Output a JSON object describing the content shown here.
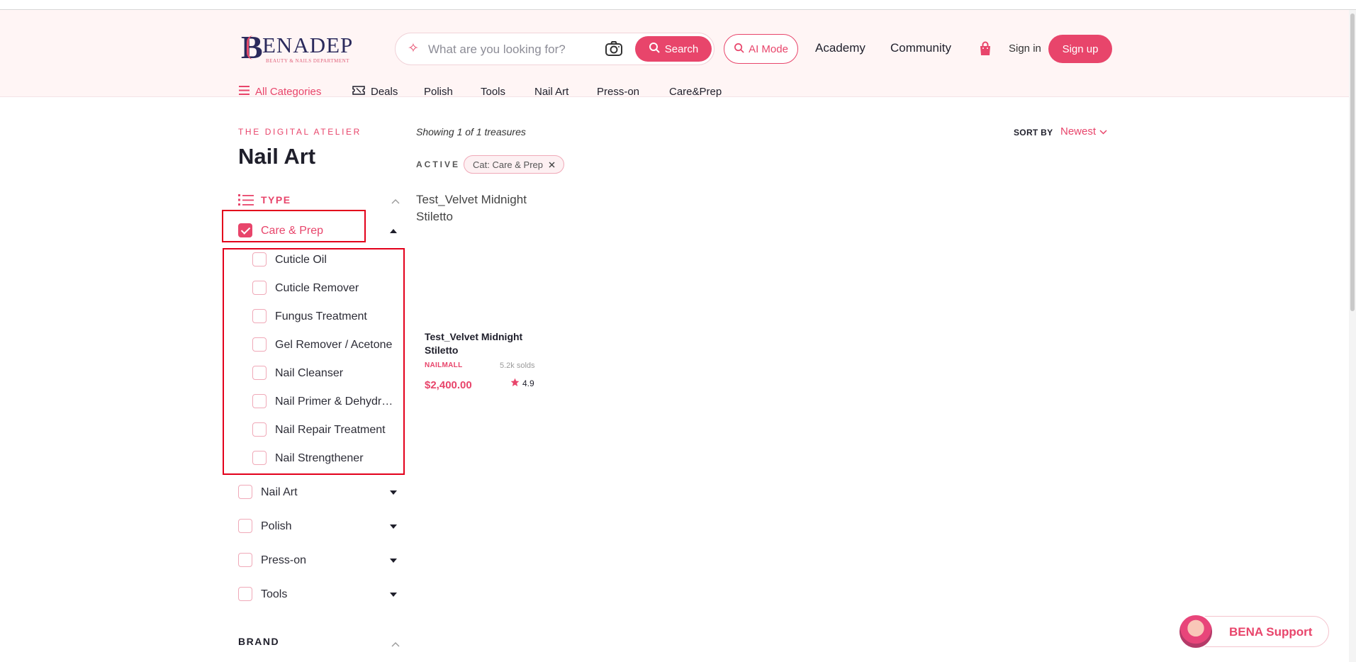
{
  "header": {
    "logo_text": "ENADEP",
    "logo_initial": "B",
    "logo_subtitle": "BEAUTY & NAILS DEPARTMENT",
    "search": {
      "placeholder": "What are you looking for?",
      "button_label": "Search"
    },
    "ai_mode_label": "AI Mode",
    "nav_links": [
      "Academy",
      "Community"
    ],
    "signin_label": "Sign in",
    "signup_label": "Sign up"
  },
  "category_nav": {
    "all_categories": "All Categories",
    "items": [
      "Deals",
      "Polish",
      "Tools",
      "Nail Art",
      "Press-on",
      "Care&Prep"
    ]
  },
  "sidebar": {
    "eyebrow": "THE DIGITAL ATELIER",
    "title": "Nail Art",
    "type_heading": "TYPE",
    "categories": [
      {
        "label": "Care & Prep",
        "checked": true,
        "expanded": true
      },
      {
        "label": "Nail Art",
        "checked": false,
        "expanded": false
      },
      {
        "label": "Polish",
        "checked": false,
        "expanded": false
      },
      {
        "label": "Press-on",
        "checked": false,
        "expanded": false
      },
      {
        "label": "Tools",
        "checked": false,
        "expanded": false
      }
    ],
    "subcategories": [
      "Cuticle Oil",
      "Cuticle Remover",
      "Fungus Treatment",
      "Gel Remover / Acetone",
      "Nail Cleanser",
      "Nail Primer & Dehydrator",
      "Nail Repair Treatment",
      "Nail Strengthener"
    ],
    "brand_heading": "BRAND"
  },
  "results": {
    "showing": "Showing 1 of 1 treasures",
    "sort_label": "SORT BY",
    "sort_value": "Newest",
    "active_label": "ACTIVE",
    "active_filter": "Cat: Care & Prep",
    "products": [
      {
        "image_alt": "Test_Velvet Midnight Stiletto",
        "name": "Test_Velvet Midnight Stiletto",
        "store": "NAILMALL",
        "sold": "5.2k solds",
        "price": "$2,400.00",
        "rating": "4.9"
      }
    ]
  },
  "support": {
    "label": "BENA Support"
  },
  "colors": {
    "accent": "#e8456b",
    "header_bg": "#fff5f5",
    "highlight_box": "#e3001b",
    "logo_navy": "#2b2a5c"
  }
}
